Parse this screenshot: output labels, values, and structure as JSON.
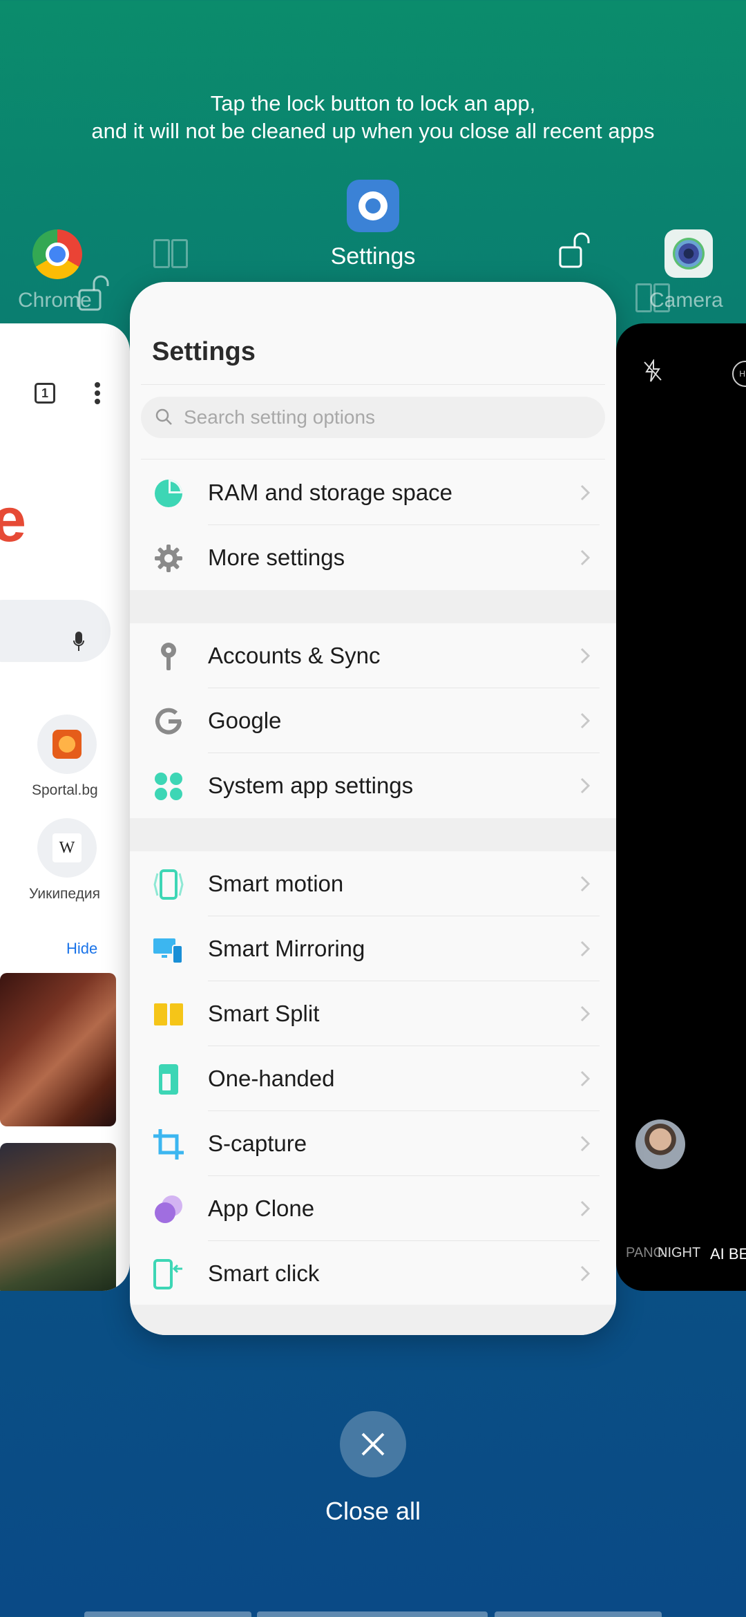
{
  "hint": {
    "line1": "Tap the lock button to lock an app,",
    "line2": "and it will not be cleaned up when you close all recent apps"
  },
  "apps": {
    "left_label": "Chrome",
    "center_label": "Settings",
    "right_label": "Camera"
  },
  "settings": {
    "title": "Settings",
    "search_placeholder": "Search setting options",
    "group1": [
      {
        "label": "RAM and storage space",
        "icon": "pie-chart-icon"
      },
      {
        "label": "More settings",
        "icon": "gear-icon"
      }
    ],
    "group2": [
      {
        "label": "Accounts & Sync",
        "icon": "key-icon"
      },
      {
        "label": "Google",
        "icon": "google-icon"
      },
      {
        "label": "System app settings",
        "icon": "apps-grid-icon"
      }
    ],
    "group3": [
      {
        "label": "Smart motion",
        "icon": "phone-motion-icon"
      },
      {
        "label": "Smart Mirroring",
        "icon": "mirroring-icon"
      },
      {
        "label": "Smart Split",
        "icon": "split-screen-icon"
      },
      {
        "label": "One-handed",
        "icon": "one-handed-icon"
      },
      {
        "label": "S-capture",
        "icon": "crop-icon"
      },
      {
        "label": "App Clone",
        "icon": "app-clone-icon"
      },
      {
        "label": "Smart click",
        "icon": "smart-click-icon"
      }
    ]
  },
  "chrome_card": {
    "tab_count": "1",
    "logo_letter": "e",
    "shortcut1": "Sportal.bg",
    "shortcut2": "Уикипедия",
    "shortcut2_letter": "W",
    "hide": "Hide"
  },
  "camera_card": {
    "modes": [
      "PANO",
      "NIGHT",
      "AI BEA"
    ],
    "hd": "HD"
  },
  "close_all": "Close all",
  "colors": {
    "accent_teal": "#3dd6b5",
    "accent_blue": "#3b82d6",
    "accent_yellow": "#f5c518",
    "accent_purple": "#a06ee0"
  }
}
